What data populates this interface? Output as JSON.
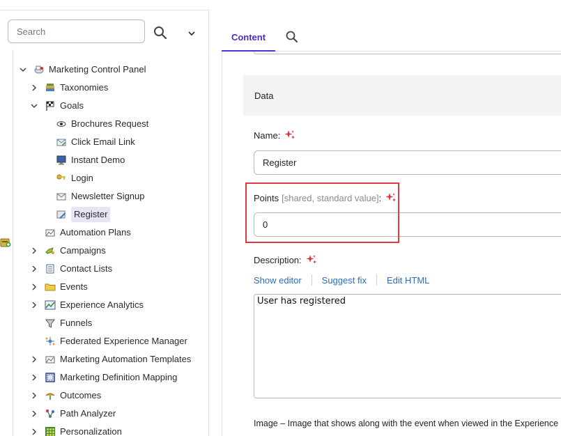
{
  "sidebar": {
    "search_placeholder": "Search",
    "tree": [
      {
        "label": "Marketing Control Panel",
        "icon": "control-panel-icon",
        "toggle": "expanded",
        "depth": 0
      },
      {
        "label": "Taxonomies",
        "icon": "books-icon",
        "toggle": "collapsed",
        "depth": 1
      },
      {
        "label": "Goals",
        "icon": "checkered-flag-icon",
        "toggle": "expanded",
        "depth": 1
      },
      {
        "label": "Brochures Request",
        "icon": "eye-icon",
        "toggle": "none",
        "depth": 2
      },
      {
        "label": "Click Email Link",
        "icon": "email-link-icon",
        "toggle": "none",
        "depth": 2
      },
      {
        "label": "Instant Demo",
        "icon": "monitor-icon",
        "toggle": "none",
        "depth": 2
      },
      {
        "label": "Login",
        "icon": "key-icon",
        "toggle": "none",
        "depth": 2
      },
      {
        "label": "Newsletter Signup",
        "icon": "envelope-icon",
        "toggle": "none",
        "depth": 2
      },
      {
        "label": "Register",
        "icon": "register-icon",
        "toggle": "none",
        "depth": 2,
        "selected": true
      },
      {
        "label": "Automation Plans",
        "icon": "automation-icon",
        "toggle": "none",
        "depth": 1
      },
      {
        "label": "Campaigns",
        "icon": "campaign-icon",
        "toggle": "collapsed",
        "depth": 1
      },
      {
        "label": "Contact Lists",
        "icon": "list-icon",
        "toggle": "collapsed",
        "depth": 1
      },
      {
        "label": "Events",
        "icon": "folder-icon",
        "toggle": "collapsed",
        "depth": 1
      },
      {
        "label": "Experience Analytics",
        "icon": "analytics-icon",
        "toggle": "collapsed",
        "depth": 1
      },
      {
        "label": "Funnels",
        "icon": "funnel-icon",
        "toggle": "none",
        "depth": 1
      },
      {
        "label": "Federated Experience Manager",
        "icon": "network-icon",
        "toggle": "none",
        "depth": 1
      },
      {
        "label": "Marketing Automation Templates",
        "icon": "automation-icon",
        "toggle": "collapsed",
        "depth": 1
      },
      {
        "label": "Marketing Definition Mapping",
        "icon": "mapping-icon",
        "toggle": "collapsed",
        "depth": 1
      },
      {
        "label": "Outcomes",
        "icon": "outcomes-icon",
        "toggle": "collapsed",
        "depth": 1
      },
      {
        "label": "Path Analyzer",
        "icon": "path-icon",
        "toggle": "collapsed",
        "depth": 1
      },
      {
        "label": "Personalization",
        "icon": "grid-icon",
        "toggle": "collapsed",
        "depth": 1
      }
    ]
  },
  "tabs": {
    "content_label": "Content"
  },
  "section": {
    "title": "Data"
  },
  "fields": {
    "name_label": "Name:",
    "name_value": "Register",
    "points_label": "Points",
    "points_qualifier": "[shared, standard value]",
    "points_colon": ":",
    "points_value": "0",
    "description_label": "Description:",
    "show_editor": "Show editor",
    "suggest_fix": "Suggest fix",
    "edit_html": "Edit HTML",
    "description_value": "User has registered",
    "image_note": "Image – Image that shows along with the event when viewed in the Experience Profile"
  },
  "colors": {
    "accent": "#5a2fcf",
    "highlight": "#e03a3a",
    "link": "#2a6ebd",
    "sparkle": "#e0333a"
  }
}
